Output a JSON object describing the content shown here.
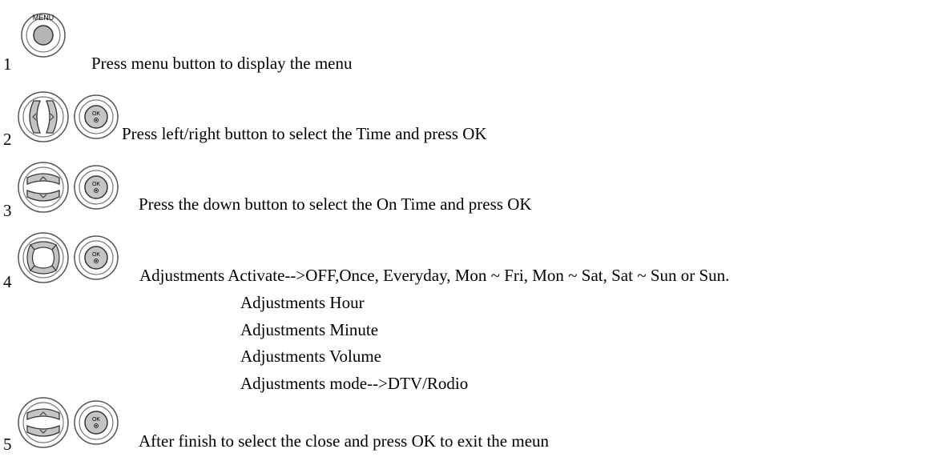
{
  "steps": [
    {
      "number": "1",
      "icons": [
        "menu-button-icon"
      ],
      "button_label": "MENU",
      "text": "Press menu button to display the menu"
    },
    {
      "number": "2",
      "icons": [
        "left-right-button-icon",
        "ok-button-icon"
      ],
      "text": "Press left/right button to select the Time and press OK"
    },
    {
      "number": "3",
      "icons": [
        "up-down-button-icon",
        "ok-button-icon"
      ],
      "text": "Press the down button to select the On Time and press OK"
    },
    {
      "number": "4",
      "icons": [
        "four-way-button-icon",
        "ok-button-icon"
      ],
      "text": "Adjustments Activate-->OFF,Once, Everyday, Mon ~ Fri, Mon ~ Sat, Sat ~ Sun or Sun.",
      "sub_items": [
        "Adjustments Hour",
        "Adjustments Minute",
        "Adjustments Volume",
        "Adjustments mode-->DTV/Rodio"
      ]
    },
    {
      "number": "5",
      "icons": [
        "up-down-button-icon",
        "ok-button-icon"
      ],
      "text": "After finish to select the close and press OK to exit the meun"
    }
  ],
  "ok_label": "OK"
}
